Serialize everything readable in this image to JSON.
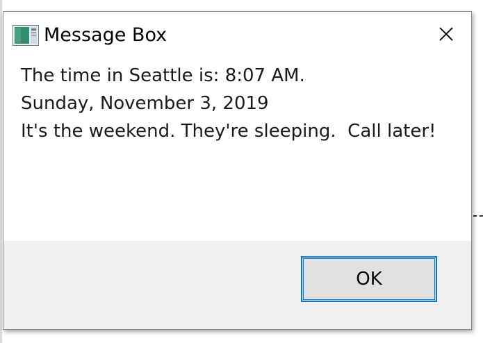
{
  "window": {
    "title": "Message Box",
    "close_icon": "close-icon",
    "app_icon": "application-window-icon"
  },
  "message": {
    "lines": [
      "The time in Seattle is: 8:07 AM.",
      "Sunday, November 3, 2019",
      "It's the weekend. They're sleeping.  Call later!"
    ]
  },
  "buttons": {
    "ok_label": "OK"
  },
  "colors": {
    "accent_focus": "#0078d7",
    "footer_bg": "#f0f0f0",
    "button_bg": "#e1e1e1"
  }
}
